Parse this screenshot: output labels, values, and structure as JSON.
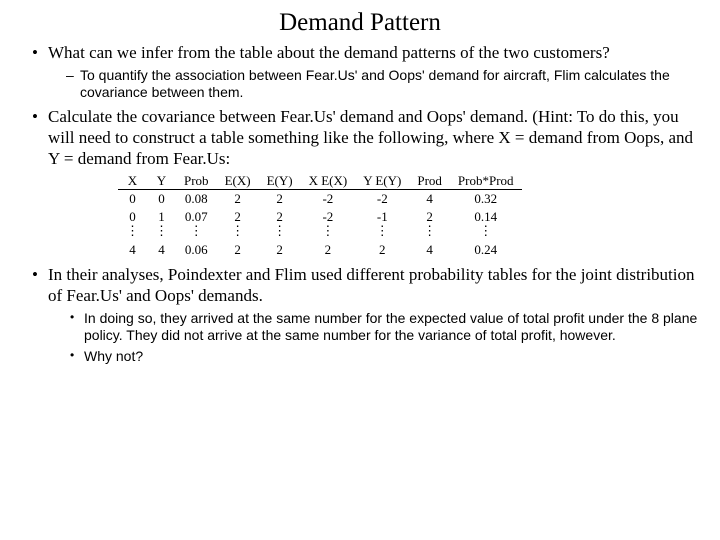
{
  "title": "Demand Pattern",
  "bullets": {
    "b1": "What can we infer from the table about the demand patterns of the two customers?",
    "b1a": "To quantify the association between Fear.Us' and Oops' demand for aircraft, Flim calculates the covariance between them.",
    "b2": "Calculate the covariance between Fear.Us' demand and Oops' demand. (Hint: To do this, you will need to construct a table something like the following, where X = demand from Oops, and Y = demand from Fear.Us:",
    "b3": "In their analyses, Poindexter and Flim used different probability tables for the joint distribution of Fear.Us' and Oops' demands.",
    "b3a": "In doing so, they arrived at the same number for the expected value of total profit under the 8 plane policy. They did not arrive at the same number for the variance of total profit, however.",
    "b3b": "Why not?"
  },
  "table": {
    "headers": [
      "X",
      "Y",
      "Prob",
      "E(X)",
      "E(Y)",
      "X E(X)",
      "Y E(Y)",
      "Prod",
      "Prob*Prod"
    ],
    "rows": [
      [
        "0",
        "0",
        "0.08",
        "2",
        "2",
        "-2",
        "-2",
        "4",
        "0.32"
      ],
      [
        "0",
        "1",
        "0.07",
        "2",
        "2",
        "-2",
        "-1",
        "2",
        "0.14"
      ],
      [
        "⋮",
        "⋮",
        "⋮",
        "⋮",
        "⋮",
        "⋮",
        "⋮",
        "⋮",
        "⋮"
      ],
      [
        "4",
        "4",
        "0.06",
        "2",
        "2",
        "2",
        "2",
        "4",
        "0.24"
      ]
    ]
  }
}
